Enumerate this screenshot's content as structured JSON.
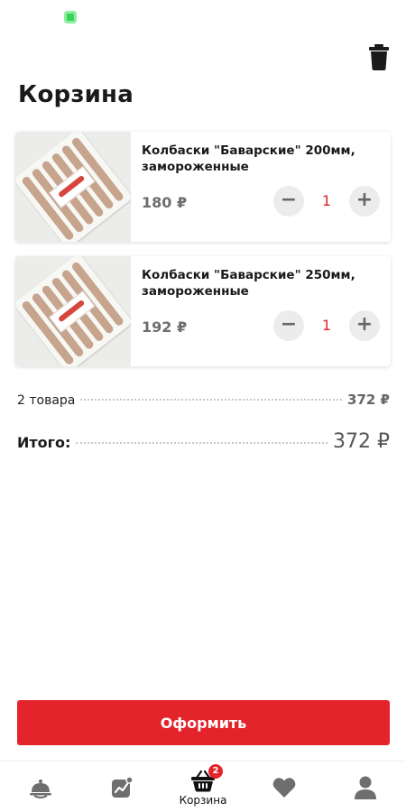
{
  "page": {
    "title": "Корзина"
  },
  "cart": {
    "items": [
      {
        "name": "Колбаски \"Баварские\" 200мм, замороженные",
        "price": "180 ₽",
        "quantity": "1"
      },
      {
        "name": "Колбаски \"Баварские\" 250мм, замороженные",
        "price": "192 ₽",
        "quantity": "1"
      }
    ],
    "stepper": {
      "minus": "−",
      "plus": "+"
    }
  },
  "summary": {
    "count_label": "2 товара",
    "count_value": "372 ₽",
    "total_label": "Итого:",
    "total_value": "372 ₽"
  },
  "checkout": {
    "label": "Оформить"
  },
  "tabbar": {
    "tabs": [
      {
        "icon": "catalog-cloche-icon",
        "label": ""
      },
      {
        "icon": "promo-chart-icon",
        "label": ""
      },
      {
        "icon": "basket-icon",
        "label": "Корзина",
        "badge": "2",
        "active": true
      },
      {
        "icon": "heart-icon",
        "label": ""
      },
      {
        "icon": "profile-icon",
        "label": ""
      }
    ]
  },
  "colors": {
    "accent": "#e3242b",
    "qty_text": "#e2252b",
    "icon_gray": "#6e6e6e",
    "status_green": "#3bd15a"
  }
}
